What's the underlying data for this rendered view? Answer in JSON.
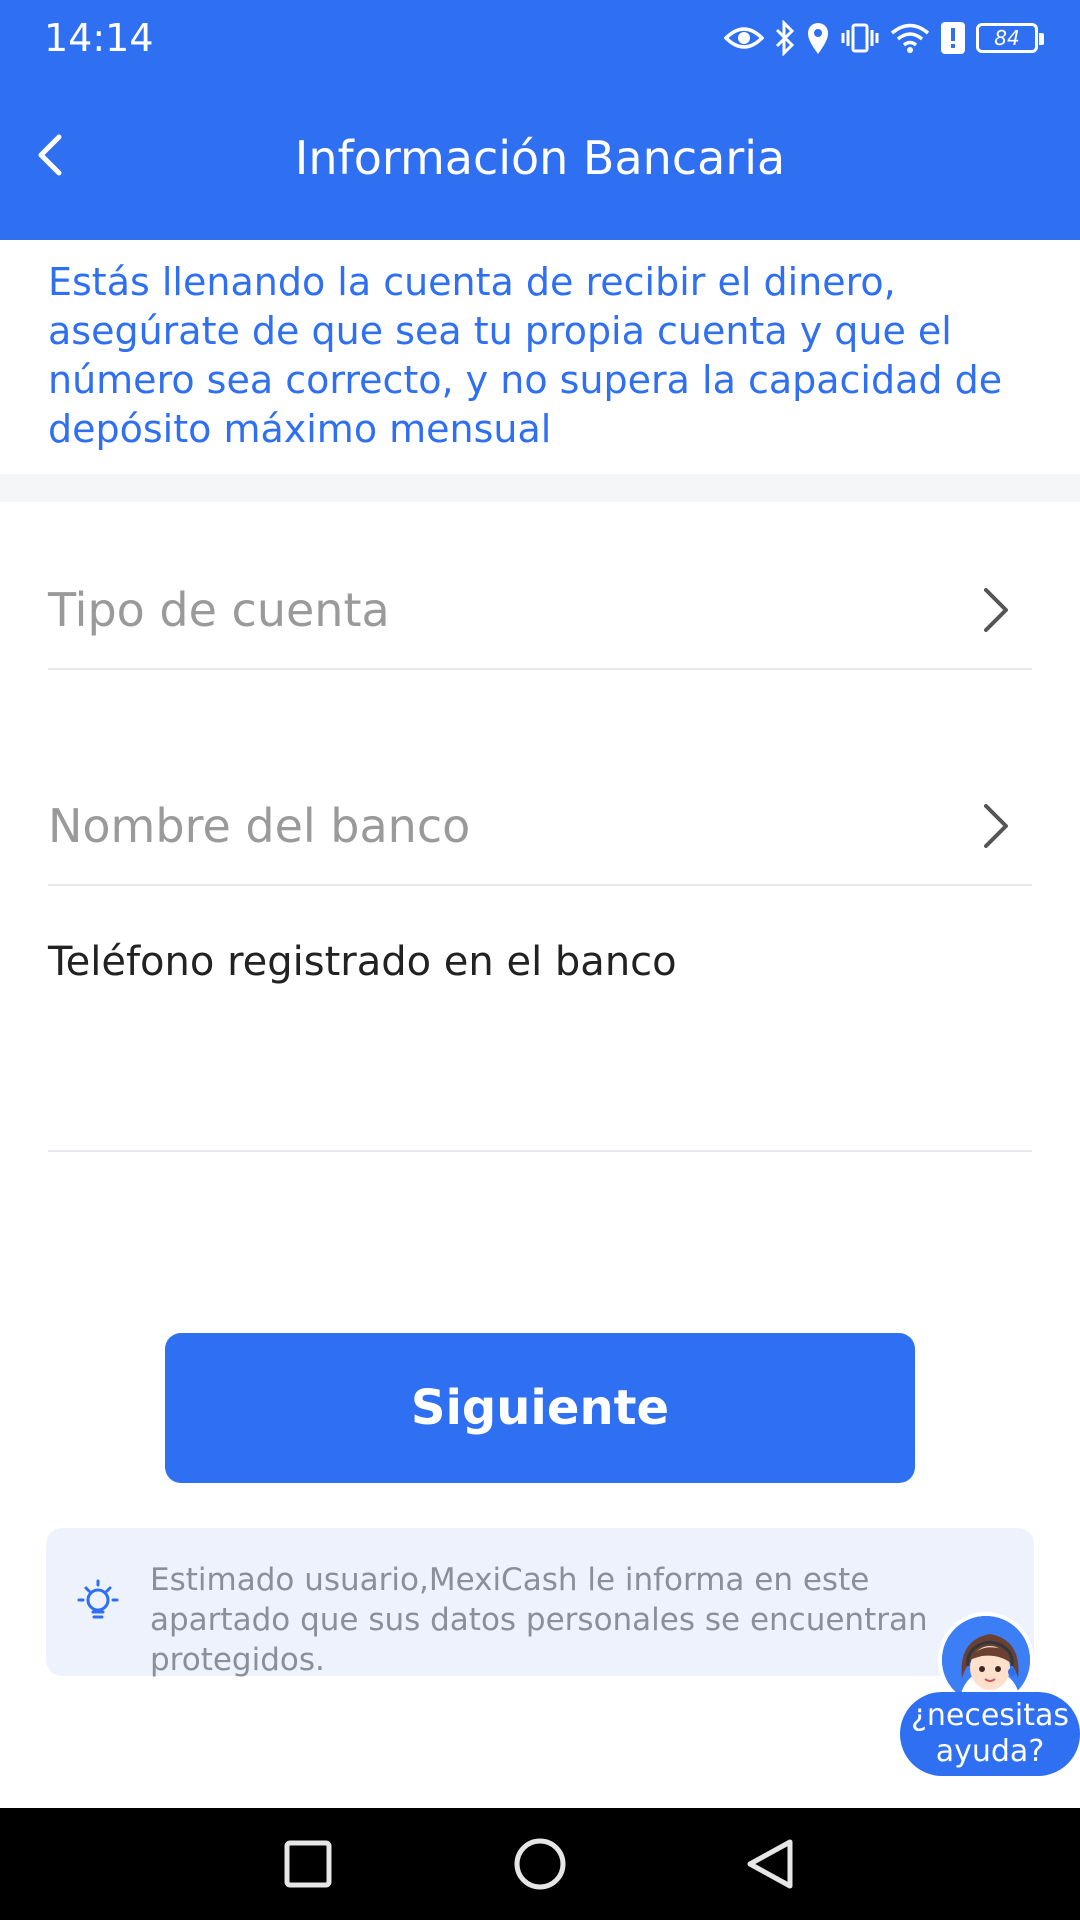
{
  "status_bar": {
    "time": "14:14",
    "battery_level": "84",
    "icons": [
      "eye-icon",
      "bluetooth-icon",
      "location-icon",
      "vibrate-icon",
      "wifi-icon",
      "alert-icon",
      "battery-icon"
    ]
  },
  "app_bar": {
    "title": "Información Bancaria",
    "back_icon": "chevron-left-icon",
    "background_color": "#2f6ff2"
  },
  "notice": {
    "text": "Estás llenando la cuenta de recibir el dinero, asegúrate de que sea tu propia cuenta y que el número sea correcto, y no supera la capacidad de depósito máximo mensual",
    "color": "#2f6ff2"
  },
  "form": {
    "account_type": {
      "placeholder": "Tipo de cuenta",
      "icon": "chevron-right-icon"
    },
    "bank_name": {
      "placeholder": "Nombre del banco",
      "icon": "chevron-right-icon"
    },
    "phone": {
      "label": "Teléfono registrado en el banco",
      "value": ""
    }
  },
  "next_button": {
    "label": "Siguiente",
    "color": "#2f6ff2"
  },
  "info_box": {
    "icon": "lightbulb-icon",
    "text": "Estimado usuario,MexiCash le informa en este apartado que sus datos personales se encuentran protegidos."
  },
  "help": {
    "label_line1": "¿necesitas",
    "label_line2": "ayuda?",
    "avatar": "support-agent-avatar"
  },
  "nav_bar": {
    "icons": [
      "recent-apps-icon",
      "home-icon",
      "back-icon"
    ]
  }
}
